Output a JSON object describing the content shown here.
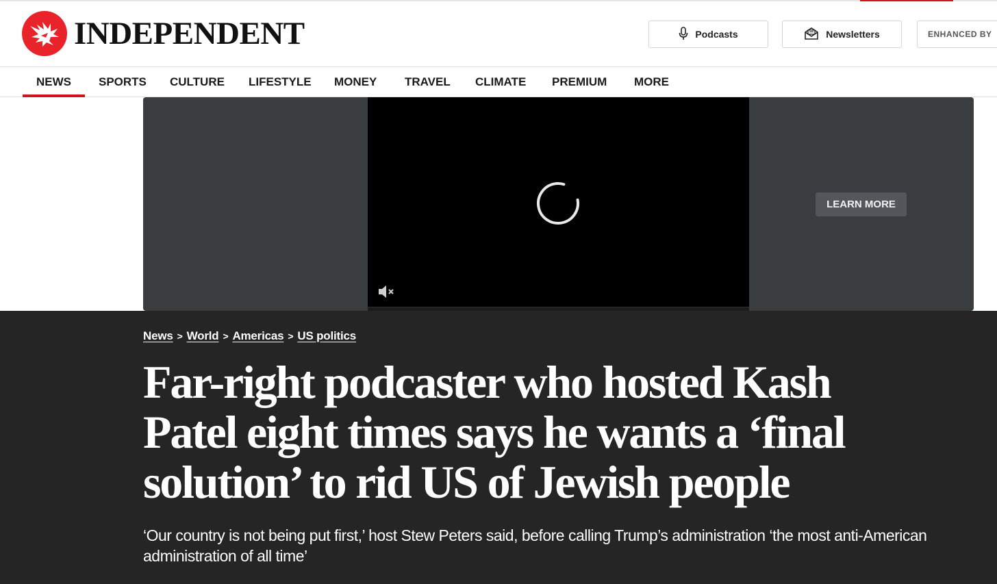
{
  "masthead": {
    "logo_text": "INDEPENDENT",
    "brand_color": "#e8242a",
    "buttons": {
      "podcasts": "Podcasts",
      "newsletters": "Newsletters",
      "enhanced": "ENHANCED BY"
    },
    "icons": [
      "eagle-logo-icon",
      "microphone-icon",
      "newsletter-icon",
      "search-icon"
    ]
  },
  "nav": {
    "items": [
      "NEWS",
      "SPORTS",
      "CULTURE",
      "LIFESTYLE",
      "MONEY",
      "TRAVEL",
      "CLIMATE",
      "PREMIUM",
      "MORE"
    ],
    "active": "NEWS",
    "accent_color": "#d1141b"
  },
  "ad": {
    "learn_more": "LEARN MORE",
    "icons": [
      "loading-spinner-icon",
      "mute-icon"
    ]
  },
  "article": {
    "breadcrumbs": [
      "News",
      "World",
      "Americas",
      "US politics"
    ],
    "headline": "Far-right podcaster who hosted Kash Patel eight times says he wants a ‘final solution’ to rid US of Jewish people",
    "standfirst": "‘Our country is not being put first,’ host Stew Peters said, before calling Trump’s administration ‘the most anti-American administration of all time’",
    "background_color": "#252525"
  }
}
